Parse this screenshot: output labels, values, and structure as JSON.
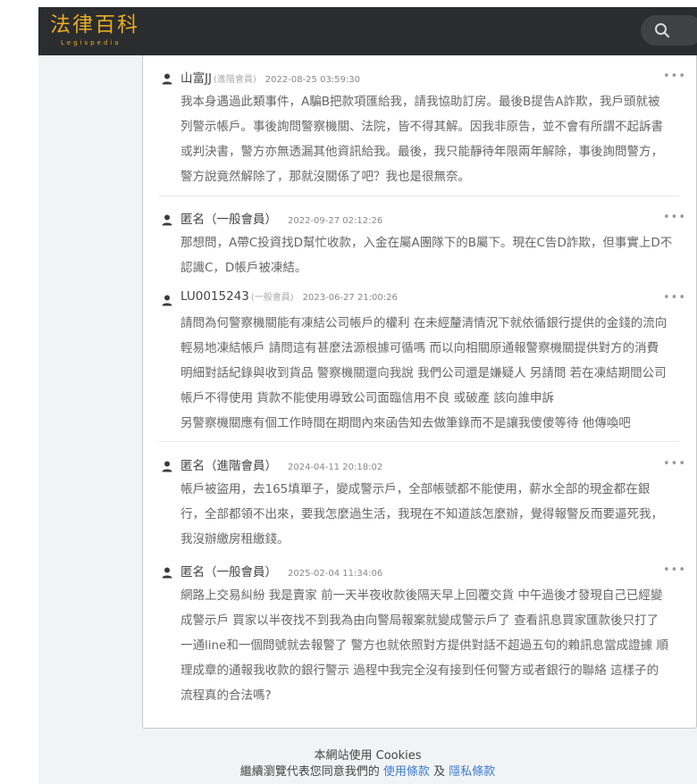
{
  "header": {
    "logo_text": "法律百科",
    "logo_subtext": "Legispedia",
    "search_icon": "search-icon"
  },
  "comments": [
    {
      "author": "山富JJ",
      "role": "(進階會員)",
      "time": "2022-08-25 03:59:30",
      "more": "•••",
      "lines": [
        "我本身遇過此類事件，A騙B把款項匯給我，請我協助訂房。最後B提告A詐欺，我戶頭就被",
        "列警示帳戶。事後詢問警察機關、法院，皆不得其解。因我非原告，並不會有所謂不起訴書",
        "或判決書，警方亦無透漏其他資訊給我。最後，我只能靜待年限兩年解除，事後詢問警方，",
        "警方說竟然解除了，那就沒關係了吧？我也是很無奈。"
      ]
    },
    {
      "author": "匿名（一般會員）",
      "role": "",
      "time": "2022-09-27 02:12:26",
      "more": "•••",
      "lines": [
        "那想問，A帶C投資找D幫忙收款，入金在屬A團隊下的B屬下。現在C告D詐欺，但事實上D不",
        "認識C，D帳戶被凍結。"
      ]
    },
    {
      "author": "LU0015243",
      "role": "(一般會員)",
      "time": "2023-06-27 21:00:26",
      "more": "•••",
      "lines": [
        "請問為何警察機關能有凍結公司帳戶的權利 在未經釐清情況下就依循銀行提供的金錢的流向",
        "輕易地凍結帳戶 請問這有甚麼法源根據可循嗎 而以向相關原通報警察機關提供對方的消費",
        "明細對話紀錄與收到貨品 警察機關還向我說 我們公司還是嫌疑人 另請問 若在凍結期間公司",
        "帳戶不得使用 貨款不能使用導致公司面臨信用不良 或破產 該向誰申訴",
        "另警察機關應有個工作時間在期間內來函告知去做筆錄而不是讓我傻傻等待 他傳喚吧"
      ]
    },
    {
      "author": "匿名（進階會員）",
      "role": "",
      "time": "2024-04-11 20:18:02",
      "more": "•••",
      "lines": [
        "帳戶被盜用，去165填單子，變成警示戶，全部帳號都不能使用，薪水全部的現金都在銀",
        "行，全部都領不出來，要我怎麼過生活，我現在不知道該怎麼辦，覺得報警反而要逼死我，",
        "我沒辦繳房租繳錢。"
      ]
    },
    {
      "author": "匿名（一般會員）",
      "role": "",
      "time": "2025-02-04 11:34:06",
      "more": "•••",
      "lines": [
        "網路上交易糾紛 我是賣家 前一天半夜收款後隔天早上回覆交貨 中午過後才發現自己已經變",
        "成警示戶 買家以半夜找不到我為由向警局報案就變成警示戶了 查看訊息買家匯款後只打了",
        "一通line和一個問號就去報警了 警方也就依照對方提供對話不超過五句的賴訊息當成證據 順",
        "理成章的通報我收款的銀行警示 過程中我完全沒有接到任何警方或者銀行的聯絡 這樣子的",
        "流程真的合法嗎?"
      ]
    }
  ],
  "cookie": {
    "line1": "本網站使用 Cookies",
    "line2_prefix": "繼續瀏覽代表您同意我們的",
    "terms_link": "使用條款",
    "and": "及",
    "privacy_link": "隱私條款"
  }
}
